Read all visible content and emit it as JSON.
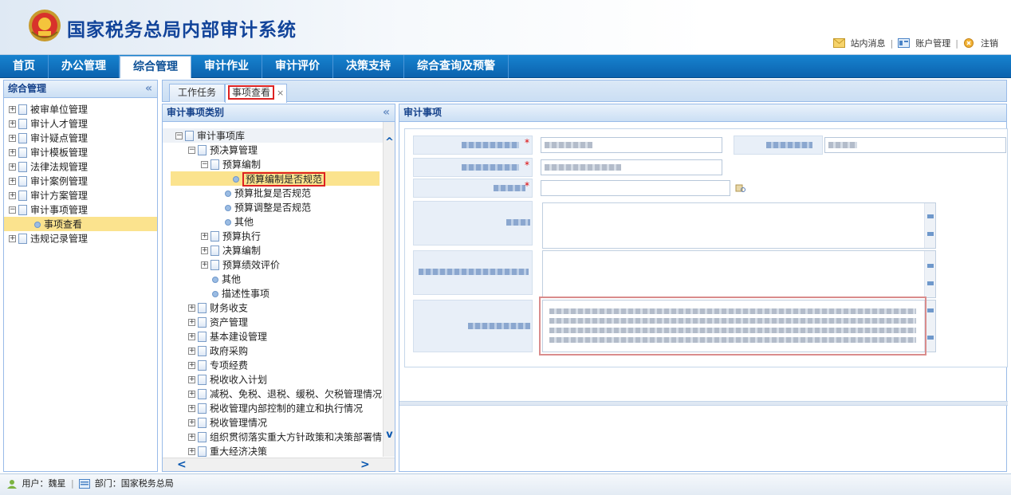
{
  "header": {
    "title": "国家税务总局内部审计系统",
    "links": {
      "messages": "站内消息",
      "account": "账户管理",
      "logout": "注销"
    }
  },
  "nav": {
    "items": [
      "首页",
      "办公管理",
      "综合管理",
      "审计作业",
      "审计评价",
      "决策支持",
      "综合查询及预警"
    ],
    "active_index": 2
  },
  "sidebar": {
    "title": "综合管理",
    "collapse": "«",
    "items": [
      {
        "label": "被审单位管理"
      },
      {
        "label": "审计人才管理"
      },
      {
        "label": "审计疑点管理"
      },
      {
        "label": "审计模板管理"
      },
      {
        "label": "法律法规管理"
      },
      {
        "label": "审计案例管理"
      },
      {
        "label": "审计方案管理"
      },
      {
        "label": "审计事项管理"
      },
      {
        "label": "事项查看"
      },
      {
        "label": "违规记录管理"
      }
    ]
  },
  "tabs": [
    {
      "label": "工作任务"
    },
    {
      "label": "事项查看",
      "close": "×"
    }
  ],
  "category_panel": {
    "title": "审计事项类别",
    "collapse": "«",
    "tree": [
      {
        "label": "审计事项库"
      },
      {
        "label": "预决算管理"
      },
      {
        "label": "预算编制"
      },
      {
        "label": "预算编制是否规范"
      },
      {
        "label": "预算批复是否规范"
      },
      {
        "label": "预算调整是否规范"
      },
      {
        "label": "其他"
      },
      {
        "label": "预算执行"
      },
      {
        "label": "决算编制"
      },
      {
        "label": "预算绩效评价"
      },
      {
        "label": "其他"
      },
      {
        "label": "描述性事项"
      },
      {
        "label": "财务收支"
      },
      {
        "label": "资产管理"
      },
      {
        "label": "基本建设管理"
      },
      {
        "label": "政府采购"
      },
      {
        "label": "专项经费"
      },
      {
        "label": "税收收入计划"
      },
      {
        "label": "减税、免税、退税、缓税、欠税管理情况"
      },
      {
        "label": "税收管理内部控制的建立和执行情况"
      },
      {
        "label": "税收管理情况"
      },
      {
        "label": "组织贯彻落实重大方针政策和决策部署情"
      },
      {
        "label": "重大经济决策"
      }
    ]
  },
  "detail_panel": {
    "title": "审计事项"
  },
  "statusbar": {
    "user": "用户：魏星",
    "dept": "部门：国家税务总局"
  },
  "colors": {
    "nav": "#0b62ae",
    "title": "#12449a",
    "highlight": "#fbe38e",
    "annotation": "#d22222"
  }
}
